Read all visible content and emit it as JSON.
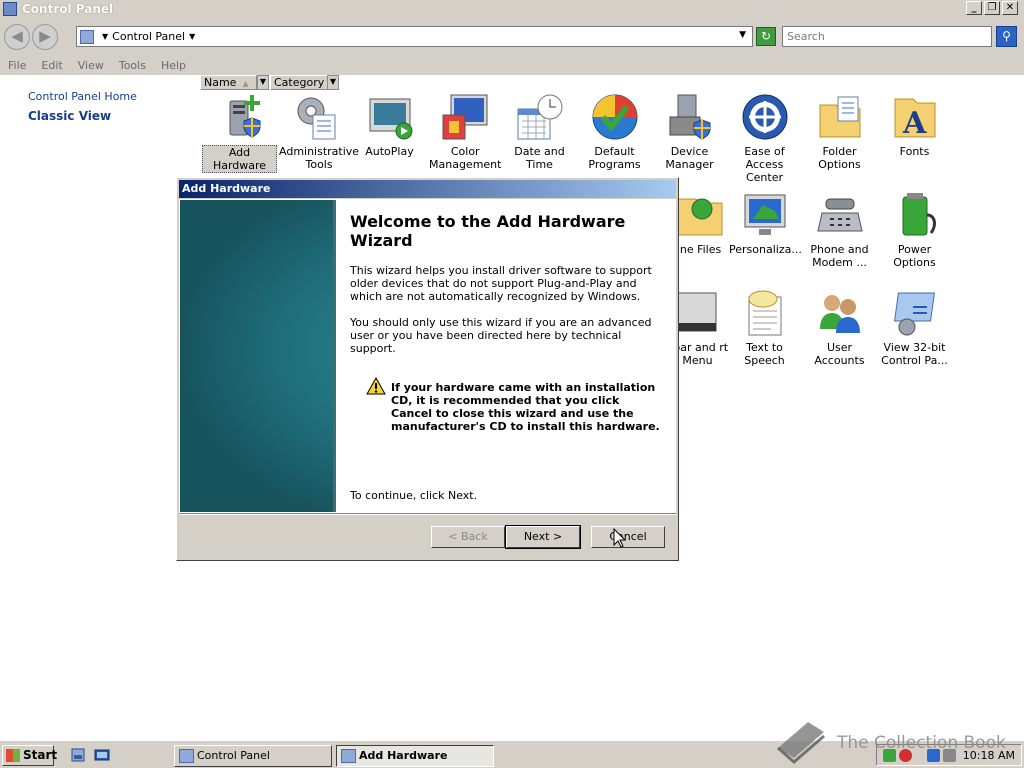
{
  "window": {
    "title": "Control Panel"
  },
  "title_buttons": {
    "minimize": "_",
    "restore": "❐",
    "close": "✕"
  },
  "address": {
    "location": "Control Panel",
    "search_placeholder": "Search"
  },
  "menu": [
    "File",
    "Edit",
    "View",
    "Tools",
    "Help"
  ],
  "left_pane": {
    "home": "Control Panel Home",
    "classic": "Classic View"
  },
  "columns": {
    "name": "Name",
    "category": "Category"
  },
  "items": [
    {
      "label": "Add Hardware",
      "icon": "add-hardware-icon",
      "selected": true
    },
    {
      "label": "Administrative Tools",
      "icon": "administrative-tools-icon"
    },
    {
      "label": "AutoPlay",
      "icon": "autoplay-icon"
    },
    {
      "label": "Color Management",
      "icon": "color-management-icon"
    },
    {
      "label": "Date and Time",
      "icon": "date-and-time-icon"
    },
    {
      "label": "Default Programs",
      "icon": "default-programs-icon"
    },
    {
      "label": "Device Manager",
      "icon": "device-manager-icon"
    },
    {
      "label": "Ease of Access Center",
      "icon": "ease-of-access-icon"
    },
    {
      "label": "Folder Options",
      "icon": "folder-options-icon"
    },
    {
      "label": "Fonts",
      "icon": "fonts-icon"
    },
    {
      "label": "line Files",
      "icon": "offline-files-icon"
    },
    {
      "label": "Personaliza...",
      "icon": "personalization-icon"
    },
    {
      "label": "Phone and Modem ...",
      "icon": "phone-and-modem-icon"
    },
    {
      "label": "Power Options",
      "icon": "power-options-icon"
    },
    {
      "label": "kbar and rt Menu",
      "icon": "taskbar-icon"
    },
    {
      "label": "Text to Speech",
      "icon": "text-to-speech-icon"
    },
    {
      "label": "User Accounts",
      "icon": "user-accounts-icon"
    },
    {
      "label": "View 32-bit Control Pa...",
      "icon": "view-32bit-icon"
    }
  ],
  "dialog": {
    "title": "Add Hardware",
    "heading": "Welcome to the Add Hardware Wizard",
    "para1": "This wizard helps you install driver software to support older devices that do not support Plug-and-Play and which are not automatically recognized by Windows.",
    "para2": "You should only use this wizard if you are an advanced user or you have been directed here by technical support.",
    "warning": "If your hardware came with an installation CD, it is recommended that you click Cancel to close this wizard and use the manufacturer's CD to install this hardware.",
    "continue": "To continue, click Next.",
    "back": "< Back",
    "next": "Next >",
    "cancel": "Cancel"
  },
  "taskbar": {
    "start": "Start",
    "buttons": [
      "Control Panel",
      "Add Hardware"
    ],
    "clock": "10:18 AM"
  },
  "watermark": "The Collection Book",
  "colors": {
    "title_gradient_start": "#0a246a",
    "title_gradient_end": "#a6caf0",
    "link": "#1a3c8c",
    "wizard_panel": "#1f6e7a"
  }
}
